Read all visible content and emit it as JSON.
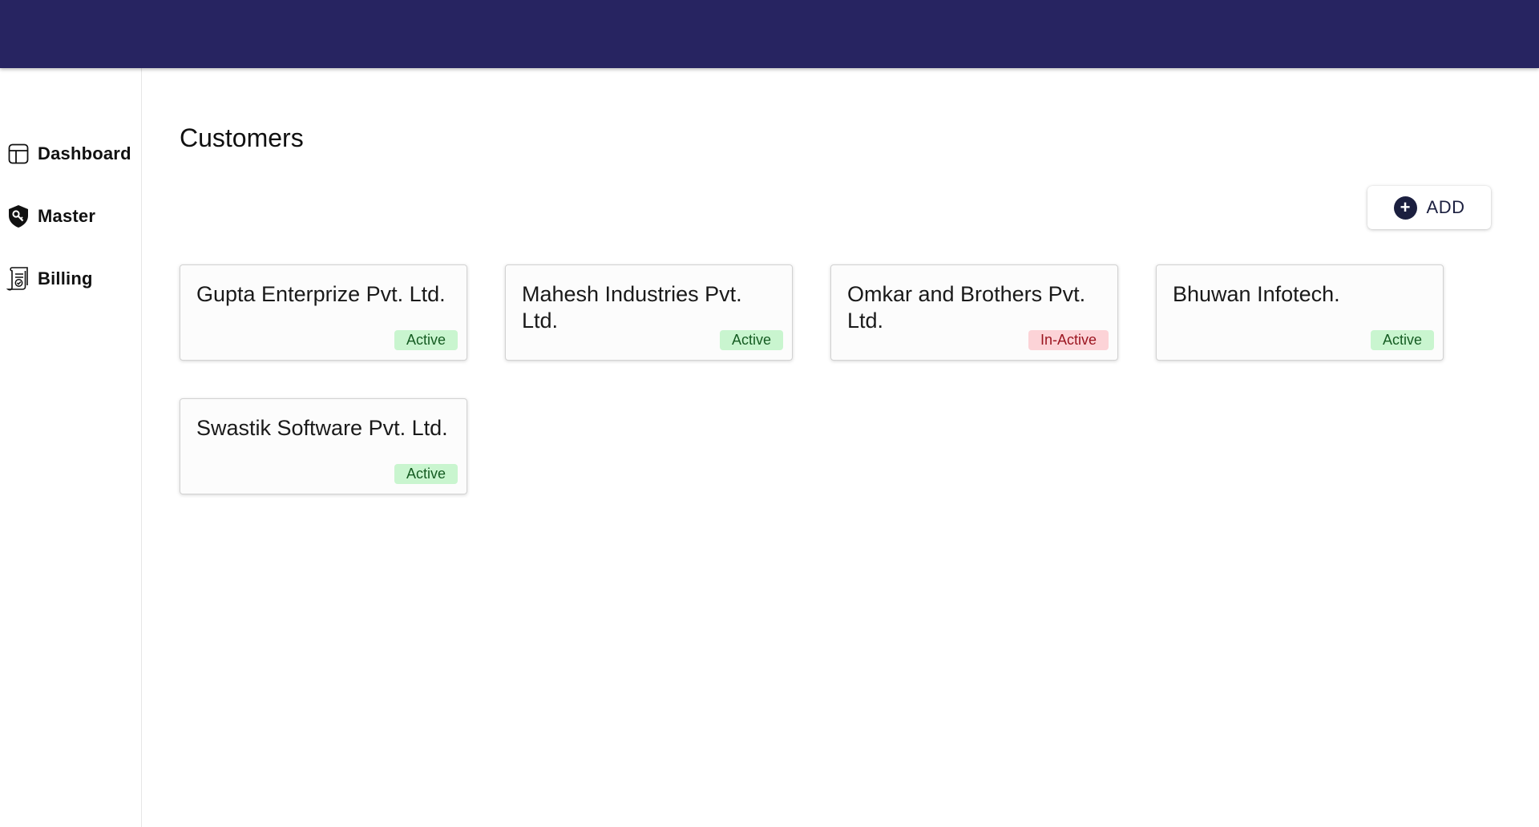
{
  "sidebar": {
    "items": [
      {
        "label": "Dashboard",
        "icon": "dashboard-icon"
      },
      {
        "label": "Master",
        "icon": "shield-key-icon"
      },
      {
        "label": "Billing",
        "icon": "bill-icon"
      }
    ]
  },
  "main": {
    "title": "Customers",
    "add_label": "ADD",
    "add_icon": "plus-circle-icon"
  },
  "customers": [
    {
      "name": "Gupta Enterprize Pvt. Ltd.",
      "status": "Active"
    },
    {
      "name": "Mahesh Industries Pvt. Ltd.",
      "status": "Active"
    },
    {
      "name": "Omkar and Brothers Pvt. Ltd.",
      "status": "In-Active"
    },
    {
      "name": "Bhuwan Infotech.",
      "status": "Active"
    },
    {
      "name": "Swastik Software Pvt. Ltd.",
      "status": "Active"
    }
  ],
  "colors": {
    "topbar": "#272461",
    "active_bg": "#c9f5cf",
    "active_text": "#155c22",
    "inactive_bg": "#fcd3d7",
    "inactive_text": "#9b1520",
    "add_icon_bg": "#1b1f3f"
  }
}
